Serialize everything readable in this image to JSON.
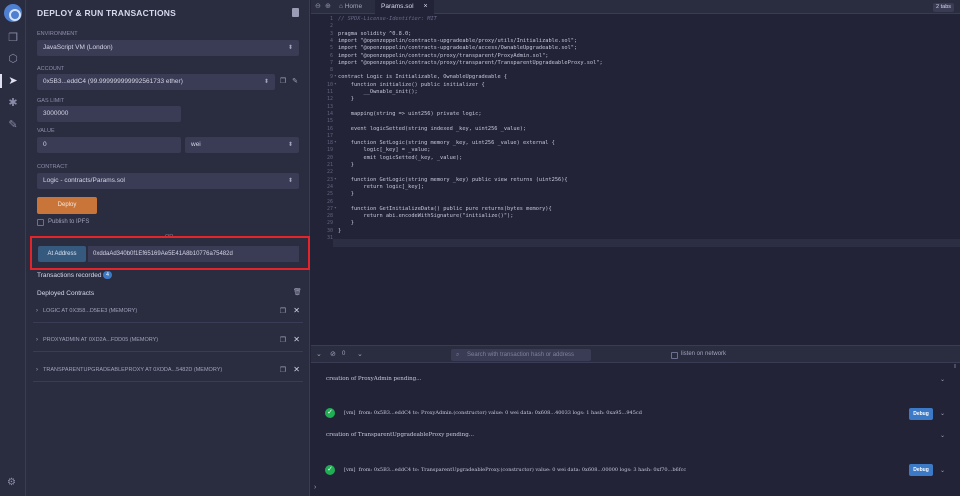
{
  "panel": {
    "title": "DEPLOY & RUN TRANSACTIONS",
    "environment_label": "ENVIRONMENT",
    "environment_value": "JavaScript VM (London)",
    "account_label": "ACCOUNT",
    "account_value": "0x5B3...eddC4 (99.999999999992561733 ether)",
    "gas_limit_label": "GAS LIMIT",
    "gas_limit_value": "3000000",
    "value_label": "VALUE",
    "value_amount": "0",
    "value_unit": "wei",
    "contract_label": "CONTRACT",
    "contract_value": "Logic - contracts/Params.sol",
    "deploy_label": "Deploy",
    "publish_label": "Publish to IPFS",
    "or_label": "OR",
    "at_address_label": "At Address",
    "at_address_value": "0xddaAd340b0f1Ef65169Ae5E41A8b10776a75482d",
    "transactions_recorded_label": "Transactions recorded",
    "transactions_recorded_count": "4",
    "deployed_contracts_label": "Deployed Contracts",
    "instances": [
      {
        "name": "LOGIC AT 0X358...D5EE3 (MEMORY)"
      },
      {
        "name": "PROXYADMIN AT 0XD2A...FDD05 (MEMORY)"
      },
      {
        "name": "TRANSPARENTUPGRADEABLEPROXY AT 0XDDA...5482D (MEMORY)"
      }
    ]
  },
  "editor": {
    "home_tab": "Home",
    "active_tab": "Params.sol",
    "tabs_count": "2 tabs",
    "lines": [
      {
        "n": "1",
        "text": "// SPDX-License-Identifier: MIT",
        "comment": true
      },
      {
        "n": "2",
        "text": ""
      },
      {
        "n": "3",
        "text": "pragma solidity ^0.8.0;"
      },
      {
        "n": "4",
        "text": "import \"@openzeppelin/contracts-upgradeable/proxy/utils/Initializable.sol\";"
      },
      {
        "n": "5",
        "text": "import \"@openzeppelin/contracts-upgradeable/access/OwnableUpgradeable.sol\";"
      },
      {
        "n": "6",
        "text": "import \"@openzeppelin/contracts/proxy/transparent/ProxyAdmin.sol\";"
      },
      {
        "n": "7",
        "text": "import \"@openzeppelin/contracts/proxy/transparent/TransparentUpgradeableProxy.sol\";"
      },
      {
        "n": "8",
        "text": ""
      },
      {
        "n": "9",
        "text": "contract Logic is Initializable, OwnableUpgradeable {",
        "fold": true
      },
      {
        "n": "10",
        "text": "    function initialize() public initializer {",
        "fold": true
      },
      {
        "n": "11",
        "text": "        __Ownable_init();"
      },
      {
        "n": "12",
        "text": "    }"
      },
      {
        "n": "13",
        "text": ""
      },
      {
        "n": "14",
        "text": "    mapping(string => uint256) private logic;"
      },
      {
        "n": "15",
        "text": ""
      },
      {
        "n": "16",
        "text": "    event logicSetted(string indexed _key, uint256 _value);"
      },
      {
        "n": "17",
        "text": ""
      },
      {
        "n": "18",
        "text": "    function SetLogic(string memory _key, uint256 _value) external {",
        "fold": true
      },
      {
        "n": "19",
        "text": "        logic[_key] = _value;"
      },
      {
        "n": "20",
        "text": "        emit logicSetted(_key, _value);"
      },
      {
        "n": "21",
        "text": "    }"
      },
      {
        "n": "22",
        "text": ""
      },
      {
        "n": "23",
        "text": "    function GetLogic(string memory _key) public view returns (uint256){",
        "fold": true
      },
      {
        "n": "24",
        "text": "        return logic[_key];"
      },
      {
        "n": "25",
        "text": "    }"
      },
      {
        "n": "26",
        "text": ""
      },
      {
        "n": "27",
        "text": "    function GetInitializeData() public pure returns(bytes memory){",
        "fold": true
      },
      {
        "n": "28",
        "text": "        return abi.encodeWithSignature(\"initialize()\");"
      },
      {
        "n": "29",
        "text": "    }"
      },
      {
        "n": "30",
        "text": "}"
      },
      {
        "n": "31",
        "text": ""
      }
    ]
  },
  "terminal": {
    "pending_count": "0",
    "listen_label": "listen on network",
    "search_placeholder": "Search with transaction hash or address",
    "debug_label": "Debug",
    "entries": [
      {
        "kind": "info",
        "text": "creation of ProxyAdmin pending..."
      },
      {
        "kind": "tx",
        "text": "[vm]  from: 0x5B3...eddC4 to: ProxyAdmin.(constructor) value: 0 wei data: 0x608...40033 logs: 1 hash: 0xa95...945cd"
      },
      {
        "kind": "info",
        "text": "creation of TransparentUpgradeableProxy pending..."
      },
      {
        "kind": "tx",
        "text": "[vm]  from: 0x5B3...eddC4 to: TransparentUpgradeableProxy.(constructor) value: 0 wei data: 0x608...00000 logs: 3 hash: 0xf70...b6fcc"
      }
    ]
  },
  "colors": {
    "accent_red_box": "#e3252b",
    "deploy_button": "#c97539",
    "at_address_button": "#36597e",
    "success": "#1fae54",
    "debug_button": "#3c7ac7"
  }
}
